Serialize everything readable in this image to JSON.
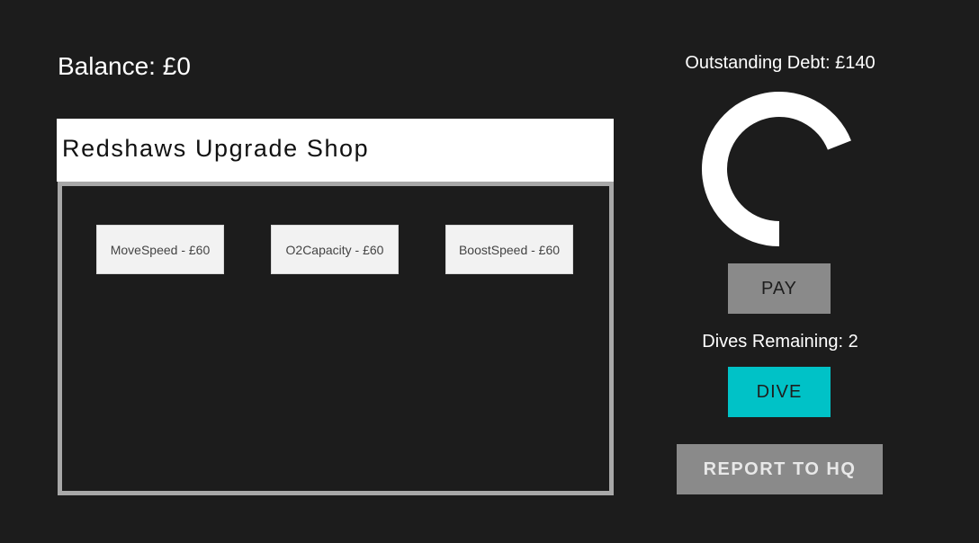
{
  "balance": {
    "label": "Balance: £0"
  },
  "shop": {
    "title": "Redshaws Upgrade Shop",
    "upgrades": [
      {
        "label": "MoveSpeed - £60"
      },
      {
        "label": "O2Capacity - £60"
      },
      {
        "label": "BoostSpeed - £60"
      }
    ]
  },
  "debt": {
    "label": "Outstanding Debt: £140",
    "gauge_fraction_filled": 0.69
  },
  "actions": {
    "pay_label": "PAY",
    "dives_label": "Dives Remaining: 2",
    "dive_label": "DIVE",
    "report_label": "REPORT TO HQ"
  },
  "colors": {
    "background": "#1c1c1c",
    "dive_button": "#00c2c7",
    "gray_button": "#8a8a8a",
    "panel_border": "#a8a8a8",
    "gauge": "#ffffff"
  }
}
